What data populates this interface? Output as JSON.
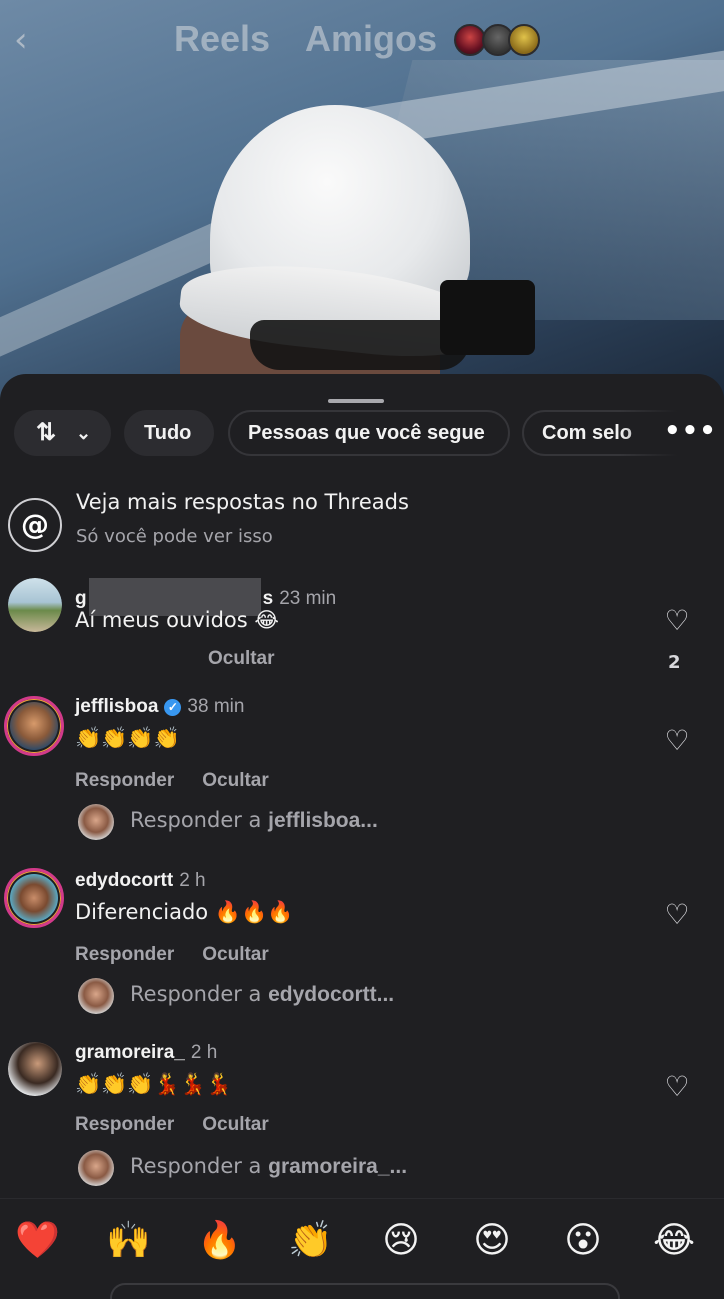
{
  "nav": {
    "back_icon": "chevron-left-icon",
    "tabs": [
      "Reels",
      "Amigos"
    ]
  },
  "filters": {
    "sort_icon": "sort-icon",
    "chips": [
      "Tudo",
      "Pessoas que você segue",
      "Com selo"
    ],
    "more_icon": "more-icon"
  },
  "threads_promo": {
    "icon": "threads-icon",
    "title": "Veja mais respostas no Threads",
    "subtitle": "Só você pode ver isso"
  },
  "comments": [
    {
      "username_start": "g",
      "username_end": "s",
      "time": "23 min",
      "text": "Aí meus ouvidos 😂",
      "actions": [
        "Ocultar"
      ],
      "likes": "2"
    },
    {
      "username": "jefflisboa",
      "verified": true,
      "time": "38 min",
      "text": "👏👏👏👏",
      "actions": [
        "Responder",
        "Ocultar"
      ],
      "reply_prefix": "Responder a",
      "reply_target": "jefflisboa..."
    },
    {
      "username": "edydocortt",
      "time": "2 h",
      "text": "Diferenciado 🔥🔥🔥",
      "actions": [
        "Responder",
        "Ocultar"
      ],
      "reply_prefix": "Responder a",
      "reply_target": "edydocortt..."
    },
    {
      "username": "gramoreira_",
      "time": "2 h",
      "text": "👏👏👏💃💃💃",
      "actions": [
        "Responder",
        "Ocultar"
      ],
      "reply_prefix": "Responder a",
      "reply_target": "gramoreira_..."
    }
  ],
  "emoji_bar": [
    "❤️",
    "🙌",
    "🔥",
    "👏",
    "😢",
    "😍",
    "😮",
    "😂"
  ],
  "colors": {
    "sheet_bg": "#1f1f22",
    "chip_bg": "#2c2c30",
    "muted_text": "#a5a5ab",
    "verified_blue": "#3897f0",
    "story_ring": "#d23a8a"
  }
}
